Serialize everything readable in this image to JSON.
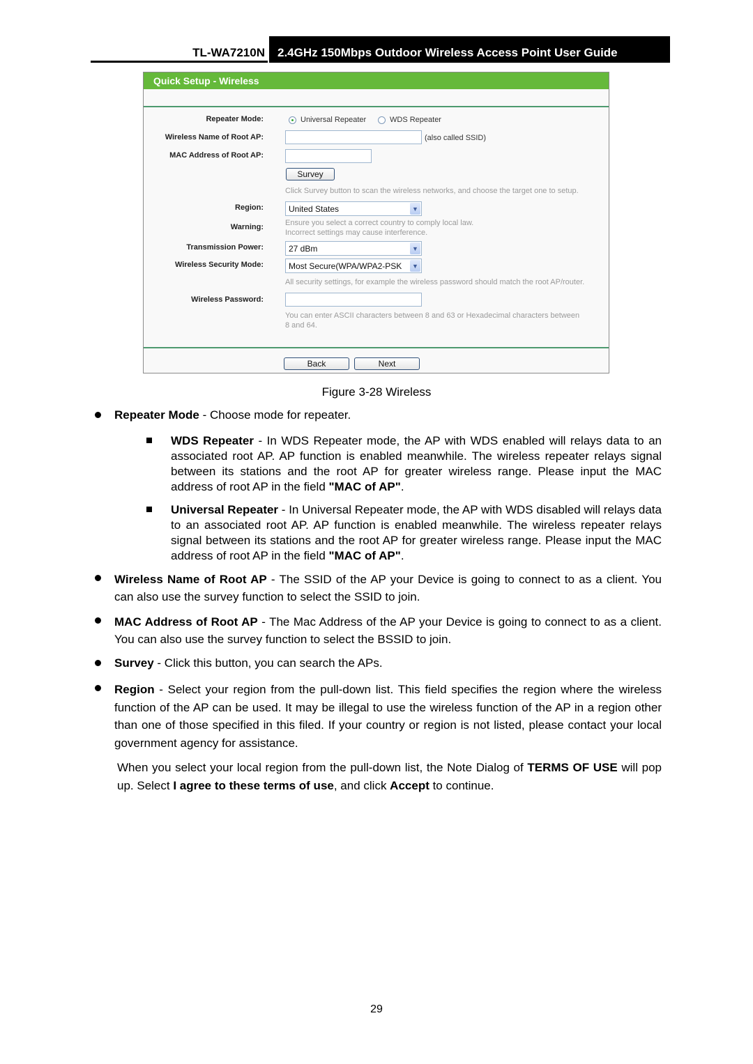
{
  "header": {
    "model": "TL-WA7210N",
    "title": "2.4GHz 150Mbps Outdoor Wireless Access Point User Guide"
  },
  "panel": {
    "title": "Quick Setup - Wireless",
    "repeater_mode": {
      "label": "Repeater Mode:",
      "options": [
        "Universal Repeater",
        "WDS Repeater"
      ],
      "selected": "Universal Repeater"
    },
    "wireless_name": {
      "label": "Wireless Name of Root AP:",
      "value": "",
      "suffix": "(also called SSID)"
    },
    "mac_address": {
      "label": "MAC Address of Root AP:",
      "value": ""
    },
    "survey_button": "Survey",
    "survey_hint": "Click Survey button to scan the wireless networks, and choose the target one to setup.",
    "region": {
      "label": "Region:",
      "value": "United States"
    },
    "warning": {
      "label": "Warning:",
      "line1": "Ensure you select a correct country to comply local law.",
      "line2": "Incorrect settings may cause interference."
    },
    "tx_power": {
      "label": "Transmission Power:",
      "value": "27 dBm"
    },
    "security_mode": {
      "label": "Wireless Security Mode:",
      "value": "Most Secure(WPA/WPA2-PSK"
    },
    "security_hint": "All security settings, for example the wireless password should match the root AP/router.",
    "password": {
      "label": "Wireless Password:",
      "value": "",
      "hint1": "You can enter ASCII characters between 8 and 63 or Hexadecimal characters between",
      "hint2": "8 and 64."
    },
    "back_button": "Back",
    "next_button": "Next"
  },
  "caption": "Figure 3-28 Wireless",
  "body": {
    "repeater_mode": {
      "term": "Repeater Mode",
      "text": " - Choose mode for repeater."
    },
    "wds": {
      "term": "WDS Repeater",
      "text": " - In WDS Repeater mode, the AP with WDS enabled will relays data to an associated root AP. AP function is enabled meanwhile. The wireless repeater relays signal between its stations and the root AP for greater wireless range. Please input the MAC address of root AP in the field ",
      "field": "\"MAC of AP\"",
      "end": "."
    },
    "universal": {
      "term": "Universal Repeater",
      "text": " - In Universal Repeater mode, the AP with WDS disabled will relays data to an associated root AP. AP function is enabled meanwhile. The wireless repeater relays signal between its stations and the root AP for greater wireless range. Please input the MAC address of root AP in the field ",
      "field": "\"MAC of AP\"",
      "end": "."
    },
    "wireless_name": {
      "term": "Wireless Name of Root AP",
      "text": " - The SSID of the AP your Device is going to connect to as a client. You can also use the survey function to select the SSID to join."
    },
    "mac": {
      "term": "MAC Address of Root AP",
      "text": " - The Mac Address of the AP your Device is going to connect to as a client. You can also use the survey function to select the BSSID to join."
    },
    "survey": {
      "term": "Survey",
      "text": " - Click this button, you can search the APs."
    },
    "region": {
      "term": "Region",
      "text": " - Select your region from the pull-down list. This field specifies the region where the wireless function of the AP can be used. It may be illegal to use the wireless function of the AP in a region other than one of those specified in this filed. If your country or region is not listed, please contact your local government agency for assistance."
    },
    "note": {
      "t1": "When you select your local region from the pull-down list, the Note Dialog of ",
      "b1": "TERMS OF USE",
      "t2": " will pop up. Select ",
      "b2": "I agree to these terms of use",
      "t3": ", and click ",
      "b3": "Accept",
      "t4": " to continue."
    }
  },
  "page_number": "29"
}
